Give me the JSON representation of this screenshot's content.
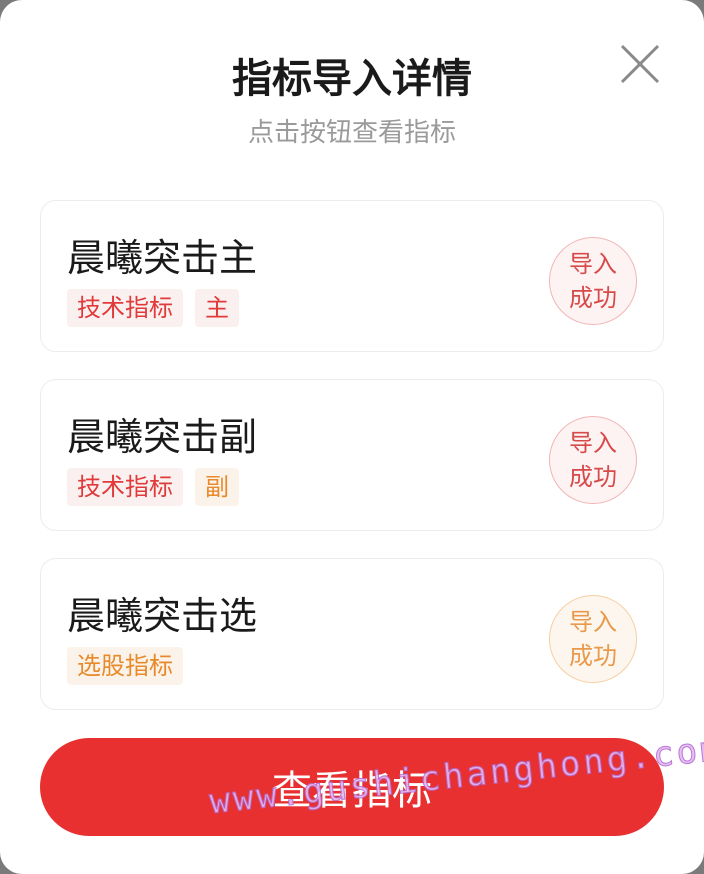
{
  "dialog": {
    "title": "指标导入详情",
    "subtitle": "点击按钮查看指标",
    "close_icon": "close-icon"
  },
  "cards": [
    {
      "name": "晨曦突击主",
      "tags": [
        {
          "text": "技术指标",
          "color": "#e13a3a"
        },
        {
          "text": "主",
          "color": "#e13a3a"
        }
      ],
      "status_line1": "导入",
      "status_line2": "成功",
      "status_color": "#d84a4a"
    },
    {
      "name": "晨曦突击副",
      "tags": [
        {
          "text": "技术指标",
          "color": "#e13a3a"
        },
        {
          "text": "副",
          "color": "#e88a2a"
        }
      ],
      "status_line1": "导入",
      "status_line2": "成功",
      "status_color": "#d84a4a"
    },
    {
      "name": "晨曦突击选",
      "tags": [
        {
          "text": "选股指标",
          "color": "#e88a2a"
        }
      ],
      "status_line1": "导入",
      "status_line2": "成功",
      "status_color": "#e89a4a"
    }
  ],
  "button": {
    "label": "查看指标",
    "color": "#e93030"
  },
  "watermark": "www.gushichanghong.com"
}
